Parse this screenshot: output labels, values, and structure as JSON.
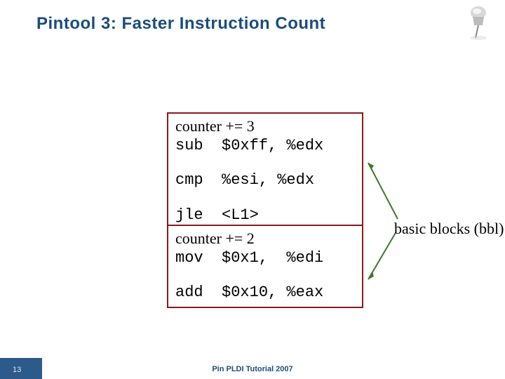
{
  "title": "Pintool 3: Faster Instruction Count",
  "block1": {
    "counter": "counter += 3",
    "l1": "sub  $0xff, %edx",
    "l2": "cmp  %esi, %edx",
    "l3": "jle  <L1>"
  },
  "block2": {
    "counter": "counter += 2",
    "l1": "mov  $0x1,  %edi",
    "l2": "add  $0x10, %eax"
  },
  "label": "basic blocks (bbl)",
  "footer": {
    "num": "13",
    "text": "Pin PLDI Tutorial 2007"
  }
}
